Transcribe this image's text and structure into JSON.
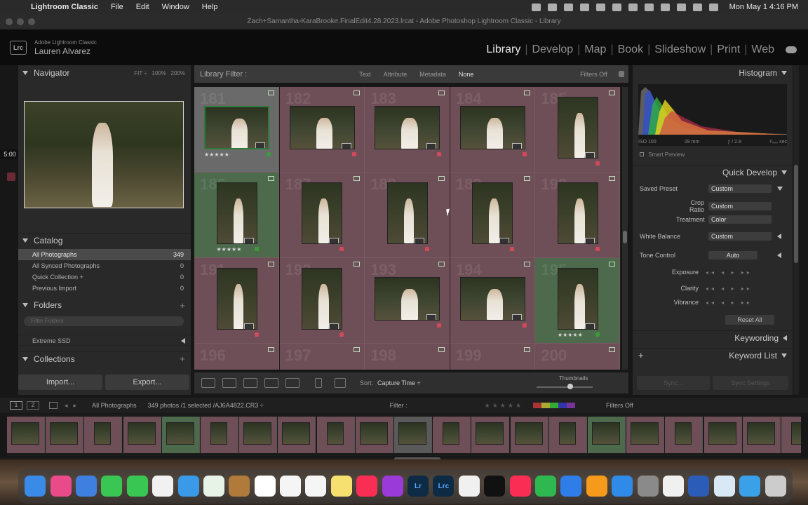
{
  "menubar": {
    "app_name": "Lightroom Classic",
    "menus": [
      "File",
      "Edit",
      "Window",
      "Help"
    ],
    "clock": "Mon May 1  4:16 PM"
  },
  "window": {
    "title": "Zach+Samantha-KaraBrooke.FinalEdit4.28.2023.lrcat - Adobe Photoshop Lightroom Classic - Library"
  },
  "identity": {
    "logo": "Lrc",
    "product": "Adobe Lightroom Classic",
    "user": "Lauren Alvarez"
  },
  "modules": [
    "Library",
    "Develop",
    "Map",
    "Book",
    "Slideshow",
    "Print",
    "Web"
  ],
  "active_module": "Library",
  "navigator": {
    "title": "Navigator",
    "zoom_options": [
      "FIT ÷",
      "100%",
      "200%"
    ]
  },
  "catalog": {
    "title": "Catalog",
    "items": [
      {
        "label": "All Photographs",
        "count": "349"
      },
      {
        "label": "All Synced Photographs",
        "count": "0"
      },
      {
        "label": "Quick Collection +",
        "count": "0"
      },
      {
        "label": "Previous Import",
        "count": "0"
      }
    ]
  },
  "folders": {
    "title": "Folders",
    "search_placeholder": "Filter Folders",
    "volume": "Extreme SSD"
  },
  "collections": {
    "title": "Collections"
  },
  "left_buttons": {
    "import": "Import...",
    "export": "Export..."
  },
  "library_filter": {
    "label": "Library Filter :",
    "options": [
      "Text",
      "Attribute",
      "Metadata",
      "None"
    ],
    "filters_status": "Filters Off"
  },
  "grid": {
    "cells": [
      {
        "num": "181",
        "orient": "land",
        "stars": "★★★★★",
        "selected": true,
        "tint": "#5a5a5a",
        "flag": "#3b9a3b"
      },
      {
        "num": "182",
        "orient": "land",
        "stars": "",
        "selected": false,
        "tint": "#6f4f57",
        "flag": "#d04a5a"
      },
      {
        "num": "183",
        "orient": "land",
        "stars": "",
        "selected": false,
        "tint": "#6f4f57",
        "flag": "#d04a5a"
      },
      {
        "num": "184",
        "orient": "land",
        "stars": "",
        "selected": false,
        "tint": "#6f4f57",
        "flag": "#d04a5a"
      },
      {
        "num": "185",
        "orient": "port",
        "stars": "",
        "selected": false,
        "tint": "#6f4f57",
        "flag": "#d04a5a"
      },
      {
        "num": "186",
        "orient": "port",
        "stars": "★★★★★",
        "selected": false,
        "tint": "#4d6a4d",
        "flag": "#3b9a3b"
      },
      {
        "num": "187",
        "orient": "port",
        "stars": "",
        "selected": false,
        "tint": "#6f4f57",
        "flag": "#d04a5a"
      },
      {
        "num": "188",
        "orient": "port",
        "stars": "",
        "selected": false,
        "tint": "#6f4f57",
        "flag": "#d04a5a"
      },
      {
        "num": "189",
        "orient": "port",
        "stars": "",
        "selected": false,
        "tint": "#6f4f57",
        "flag": "#d04a5a"
      },
      {
        "num": "190",
        "orient": "port",
        "stars": "",
        "selected": false,
        "tint": "#6f4f57",
        "flag": "#d04a5a"
      },
      {
        "num": "191",
        "orient": "port",
        "stars": "",
        "selected": false,
        "tint": "#6f4f57",
        "flag": "#d04a5a"
      },
      {
        "num": "192",
        "orient": "port",
        "stars": "",
        "selected": false,
        "tint": "#6f4f57",
        "flag": "#d04a5a"
      },
      {
        "num": "193",
        "orient": "land",
        "stars": "",
        "selected": false,
        "tint": "#6f4f57",
        "flag": "#d04a5a"
      },
      {
        "num": "194",
        "orient": "land",
        "stars": "",
        "selected": false,
        "tint": "#6f4f57",
        "flag": "#d04a5a"
      },
      {
        "num": "195",
        "orient": "port",
        "stars": "★★★★★",
        "selected": false,
        "tint": "#4d6a4d",
        "flag": "#3b9a3b"
      },
      {
        "num": "196",
        "orient": "land",
        "stars": "",
        "selected": false,
        "tint": "#6f4f57",
        "flag": ""
      },
      {
        "num": "197",
        "orient": "land",
        "stars": "",
        "selected": false,
        "tint": "#6f4f57",
        "flag": ""
      },
      {
        "num": "198",
        "orient": "land",
        "stars": "",
        "selected": false,
        "tint": "#6f4f57",
        "flag": ""
      },
      {
        "num": "199",
        "orient": "land",
        "stars": "",
        "selected": false,
        "tint": "#6f4f57",
        "flag": ""
      },
      {
        "num": "200",
        "orient": "land",
        "stars": "",
        "selected": false,
        "tint": "#6f4f57",
        "flag": ""
      }
    ]
  },
  "toolbar": {
    "sort_label": "Sort:",
    "sort_value": "Capture Time ÷",
    "thumbnails_label": "Thumbnails"
  },
  "histogram": {
    "title": "Histogram",
    "iso": "ISO 100",
    "focal": "28 mm",
    "aperture": "ƒ / 2.8",
    "shutter": "¹⁄₄₀₀ sec",
    "smart_preview": "Smart Preview"
  },
  "quick_develop": {
    "title": "Quick Develop",
    "saved_preset_label": "Saved Preset",
    "saved_preset_value": "Custom",
    "crop_ratio_label": "Crop Ratio",
    "crop_ratio_value": "Custom",
    "treatment_label": "Treatment",
    "treatment_value": "Color",
    "white_balance_label": "White Balance",
    "white_balance_value": "Custom",
    "tone_control_label": "Tone Control",
    "auto_label": "Auto",
    "exposure_label": "Exposure",
    "clarity_label": "Clarity",
    "vibrance_label": "Vibrance",
    "reset_label": "Reset All"
  },
  "keywording": {
    "title": "Keywording"
  },
  "keyword_list": {
    "title": "Keyword List"
  },
  "sync": {
    "sync_label": "Sync...",
    "sync_settings_label": "Sync Settings"
  },
  "filmstrip": {
    "pages": [
      "1",
      "2"
    ],
    "source": "All Photographs",
    "status": "349 photos /1 selected /AJ6A4822.CR3 ÷",
    "filter_label": "Filter :",
    "filters_off": "Filters Off"
  },
  "timer": "5:00"
}
